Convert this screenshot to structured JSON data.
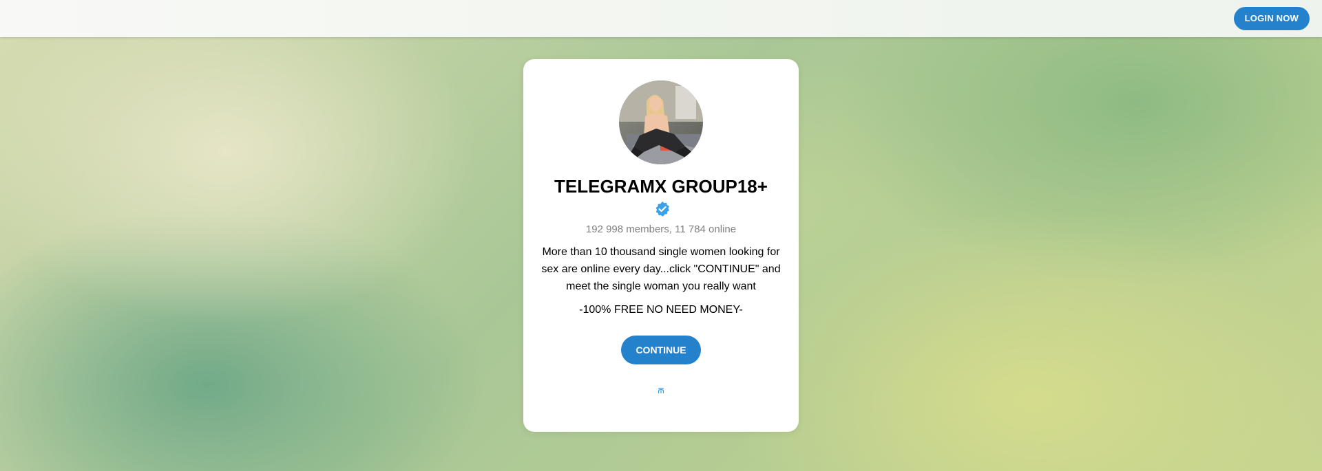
{
  "header": {
    "login_label": "LOGIN NOW"
  },
  "channel": {
    "avatar_icon": "channel-avatar",
    "title": "TELEGRAMX GROUP18+",
    "verified_icon": "verified-badge-icon",
    "stats": "192 998 members, 11 784 online",
    "description": "More than 10 thousand single women looking for sex are online every day...click \"CONTINUE\" and meet the single woman you really want",
    "free_text": "-100% FREE NO NEED MONEY-",
    "continue_label": "CONTINUE",
    "footer_icon": "telegram-mini-icon"
  },
  "colors": {
    "accent": "#2481cc",
    "verified": "#3aa0e8",
    "muted_text": "#808080"
  }
}
